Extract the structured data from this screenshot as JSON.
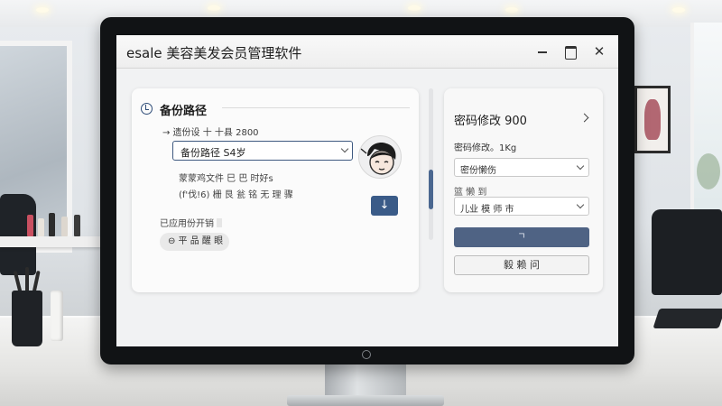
{
  "window": {
    "title": "esale 美容美发会员管理软件",
    "minimize_icon": "minimize-icon",
    "maximize_icon": "maximize-icon",
    "close_label": "✕"
  },
  "backup": {
    "section_title": "备份路径",
    "info_line": "→ 遗份设 十 十县 2800",
    "path_select_value": "备份路径 S4岁",
    "note_line_1": "蒙蒙鸡文件 巳 巴 时好s",
    "note_line_2": "(f'伐!6) 栅 艮 瓮 铭 无 理 骤",
    "download_label": "↓",
    "status_text": "已应用份开销",
    "restore_button_label": "⊖ 平 品 醒 眼",
    "avatar_icon": "user-avatar-icon"
  },
  "password": {
    "title": "密码修改 900",
    "field_label": "密码修改。1Kg",
    "select_1_value": "密份懒伤",
    "field_label_2": "篮 懒 到",
    "select_2_value": "儿业 模 师 市",
    "primary_button_label": "ㄱ",
    "secondary_button_label": "毅 赖 问"
  },
  "colors": {
    "accent": "#3a5b88",
    "primary_button": "#4f6384",
    "screen_bg": "#f1f2f3"
  }
}
